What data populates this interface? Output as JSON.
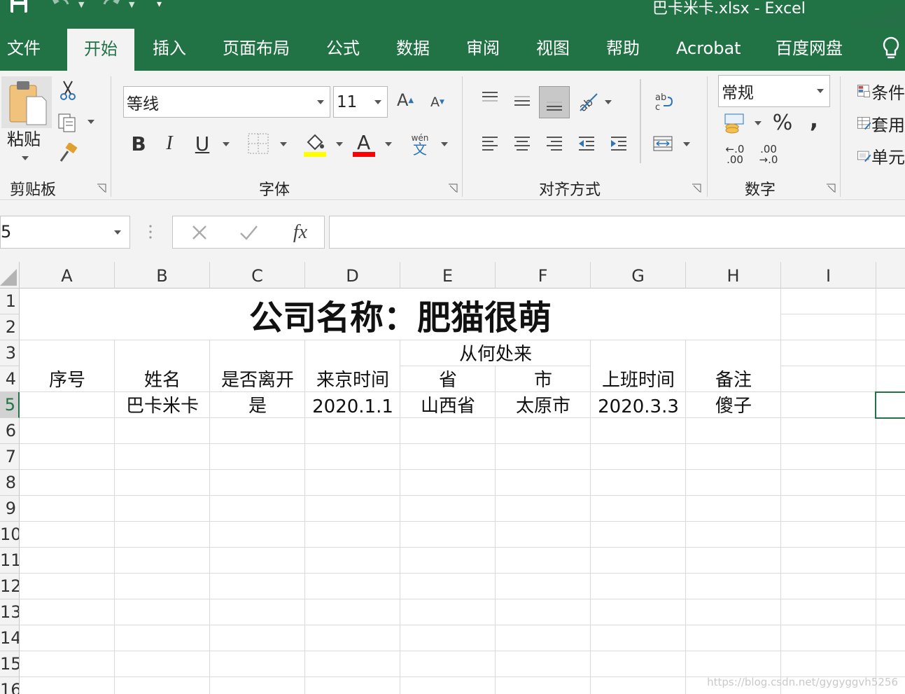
{
  "window": {
    "title": "巴卡米卡.xlsx  -  Excel"
  },
  "tabs": [
    "文件",
    "开始",
    "插入",
    "页面布局",
    "公式",
    "数据",
    "审阅",
    "视图",
    "帮助",
    "Acrobat",
    "百度网盘"
  ],
  "active_tab": "开始",
  "ribbon": {
    "clipboard": {
      "paste_label": "粘贴",
      "group_label": "剪贴板"
    },
    "font": {
      "font_name": "等线",
      "font_size": "11",
      "group_label": "字体",
      "bold": "B",
      "italic": "I",
      "underline": "U",
      "phonetic_top": "wén",
      "phonetic_bottom": "文",
      "fill_color": "#ffff00",
      "font_color": "#ff0000"
    },
    "alignment": {
      "group_label": "对齐方式"
    },
    "number": {
      "format": "常规",
      "percent": "%",
      "comma": ",",
      "dec_inc_top": "←.0",
      "dec_inc_bottom": ".00",
      "dec_dec_top": ".00",
      "dec_dec_bottom": "→.0",
      "group_label": "数字"
    },
    "styles": {
      "conditional": "条件",
      "table": "套用",
      "cell": "单元"
    }
  },
  "formula_bar": {
    "name_box": "5",
    "formula": ""
  },
  "grid": {
    "columns": [
      "A",
      "B",
      "C",
      "D",
      "E",
      "F",
      "G",
      "H",
      "I"
    ],
    "rows": [
      "1",
      "2",
      "3",
      "4",
      "5",
      "6",
      "7",
      "8",
      "9",
      "10",
      "11",
      "12",
      "13",
      "14",
      "15",
      "16"
    ],
    "title": "公司名称：肥猫很萌",
    "header": {
      "seq": "序号",
      "name": "姓名",
      "left": "是否离开",
      "arrive_time": "来京时间",
      "origin": "从何处来",
      "province": "省",
      "city": "市",
      "work_time": "上班时间",
      "remark": "备注"
    },
    "row5": [
      "",
      "巴卡米卡",
      "是",
      "2020.1.1",
      "山西省",
      "太原市",
      "2020.3.3",
      "傻子"
    ]
  },
  "watermark": "https://blog.csdn.net/gygyggvh5256",
  "colors": {
    "accent": "#217346",
    "ribbon_bg": "#f3f3f3",
    "selection": "#217346"
  }
}
